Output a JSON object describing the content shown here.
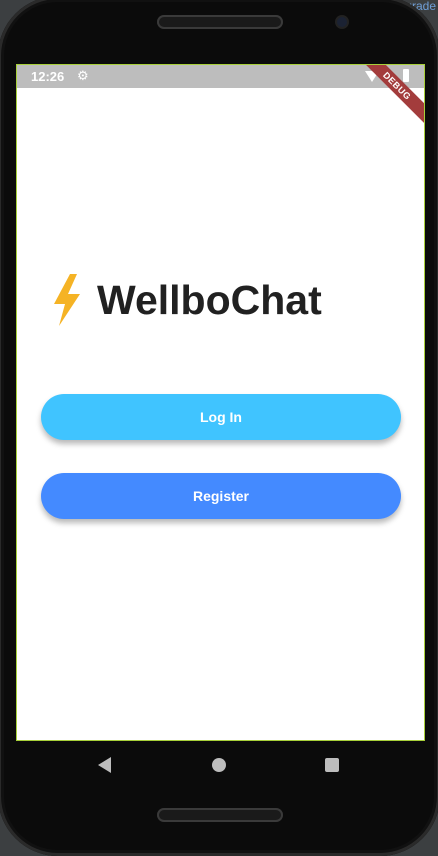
{
  "background": {
    "corner_text": "Upgrade"
  },
  "status_bar": {
    "time": "12:26",
    "gear_icon": "gear-icon",
    "wifi_icon": "wifi-icon",
    "battery_icon": "battery-icon"
  },
  "debug_banner": {
    "label": "DEBUG"
  },
  "logo": {
    "icon": "lightning-bolt-icon",
    "title": "WellboChat"
  },
  "buttons": {
    "login_label": "Log In",
    "register_label": "Register"
  },
  "nav_bar": {
    "back_icon": "back-triangle-icon",
    "home_icon": "home-circle-icon",
    "recents_icon": "recents-square-icon"
  },
  "colors": {
    "login_button": "#40c4ff",
    "register_button": "#448aff",
    "bolt": "#f5b325",
    "title_text": "#212121",
    "status_bar": "#bdbdbd",
    "debug_banner": "#a33c3c"
  }
}
